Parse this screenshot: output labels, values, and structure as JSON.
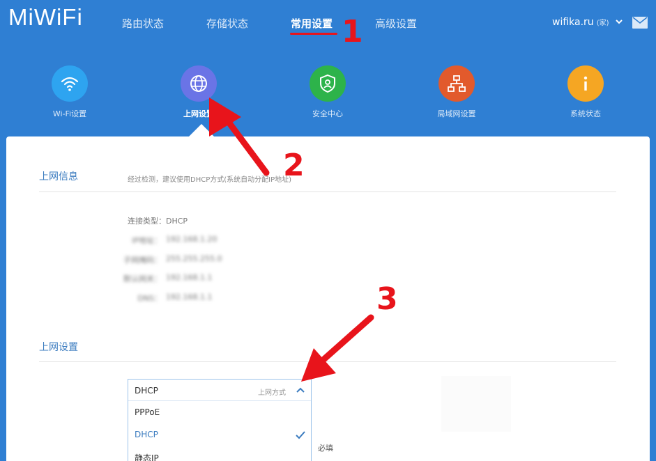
{
  "header": {
    "logo": "MiWiFi",
    "nav": [
      {
        "label": "路由状态"
      },
      {
        "label": "存储状态"
      },
      {
        "label": "常用设置"
      },
      {
        "label": "高级设置"
      }
    ],
    "account": "wifika.ru",
    "account_tag": "(家)"
  },
  "quick_icons": [
    {
      "label": "Wi-Fi设置",
      "icon": "wifi-icon",
      "color": "#2ea4f0"
    },
    {
      "label": "上网设置",
      "icon": "globe-icon",
      "color": "#6a74e6"
    },
    {
      "label": "安全中心",
      "icon": "shield-icon",
      "color": "#2db34a"
    },
    {
      "label": "局域网设置",
      "icon": "network-icon",
      "color": "#e25a2c"
    },
    {
      "label": "系统状态",
      "icon": "info-icon",
      "color": "#f5a623"
    }
  ],
  "info_section": {
    "title": "上网信息",
    "desc": "经过检测，建议使用DHCP方式(系统自动分配IP地址)",
    "connection_type_label": "连接类型：",
    "connection_type_value": "DHCP",
    "rows": [
      {
        "label": "IP地址：",
        "value": "192.168.1.20"
      },
      {
        "label": "子网掩码：",
        "value": "255.255.255.0"
      },
      {
        "label": "默认网关：",
        "value": "192.168.1.1"
      },
      {
        "label": "DNS：",
        "value": "192.168.1.1"
      }
    ]
  },
  "setup_section": {
    "title": "上网设置",
    "dropdown": {
      "selected": "DHCP",
      "hint": "上网方式",
      "options": [
        "PPPoE",
        "DHCP",
        "静态IP"
      ]
    },
    "required_label": "必填"
  },
  "annotations": [
    "1",
    "2",
    "3"
  ],
  "colors": {
    "background": "#2f7fd3",
    "accent": "#3a7bbf",
    "annotation": "#e8141b"
  }
}
